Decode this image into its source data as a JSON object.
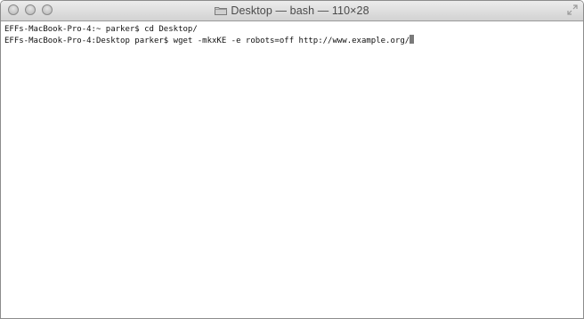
{
  "window": {
    "title": "Desktop — bash — 110×28",
    "title_icon": "folder-icon",
    "controls": [
      "close",
      "minimize",
      "zoom"
    ],
    "fullscreen_icon": "fullscreen-icon"
  },
  "terminal": {
    "lines": [
      "EFFs-MacBook-Pro-4:~ parker$ cd Desktop/",
      "EFFs-MacBook-Pro-4:Desktop parker$ wget -mkxKE -e robots=off http://www.example.org/"
    ]
  },
  "colors": {
    "title_text": "#4a4a4a",
    "terminal_text": "#111111",
    "cursor": "#7a7a7a",
    "background": "#ffffff"
  }
}
